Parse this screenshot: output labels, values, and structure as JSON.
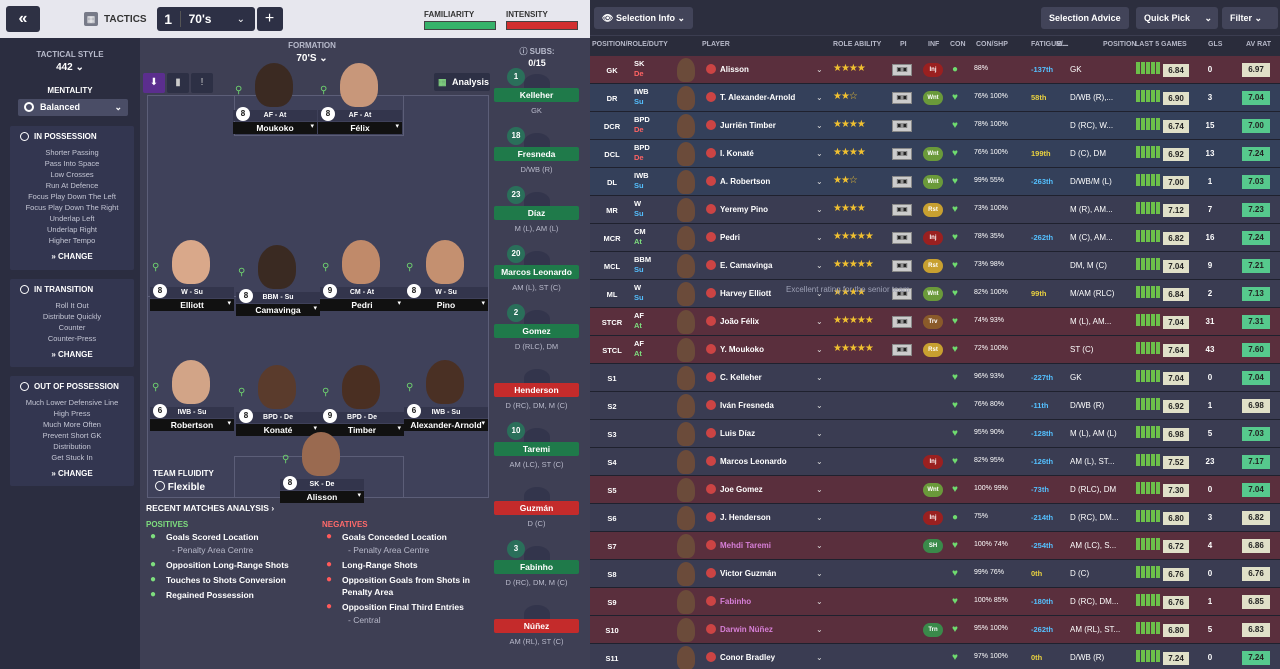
{
  "header": {
    "tactics_label": "TACTICS",
    "slot_number": "1",
    "slot_name": "70's",
    "familiarity_label": "FAMILIARITY",
    "intensity_label": "INTENSITY"
  },
  "sidebar": {
    "style_label": "TACTICAL STYLE",
    "style_value": "442",
    "mentality_label": "MENTALITY",
    "mentality_value": "Balanced",
    "possession": {
      "title": "IN POSSESSION",
      "items": [
        "Shorter Passing",
        "Pass Into Space",
        "Low Crosses",
        "Run At Defence",
        "Focus Play Down The Left",
        "Focus Play Down The Right",
        "Underlap Left",
        "Underlap Right",
        "Higher Tempo"
      ]
    },
    "transition": {
      "title": "IN TRANSITION",
      "items": [
        "Roll It Out",
        "Distribute Quickly",
        "Counter",
        "Counter-Press"
      ]
    },
    "oop": {
      "title": "OUT OF POSSESSION",
      "items": [
        "Much Lower Defensive Line",
        "High Press",
        "Much More Often",
        "Prevent Short GK",
        "Distribution",
        "Get Stuck In"
      ]
    },
    "change_label": "CHANGE"
  },
  "formation": {
    "label": "FORMATION",
    "name": "70'S",
    "analysis_label": "Analysis",
    "fluidity_label": "TEAM FLUIDITY",
    "fluidity_value": "Flexible"
  },
  "pitch_players": [
    {
      "num": "8",
      "role": "AF - At",
      "name": "Moukoko"
    },
    {
      "num": "8",
      "role": "AF - At",
      "name": "Félix"
    },
    {
      "num": "8",
      "role": "W - Su",
      "name": "Elliott"
    },
    {
      "num": "8",
      "role": "BBM - Su",
      "name": "Camavinga"
    },
    {
      "num": "9",
      "role": "CM - At",
      "name": "Pedri"
    },
    {
      "num": "8",
      "role": "W - Su",
      "name": "Pino"
    },
    {
      "num": "6",
      "role": "IWB - Su",
      "name": "Robertson"
    },
    {
      "num": "8",
      "role": "BPD - De",
      "name": "Konaté"
    },
    {
      "num": "9",
      "role": "BPD - De",
      "name": "Timber"
    },
    {
      "num": "6",
      "role": "IWB - Su",
      "name": "Alexander-Arnold"
    },
    {
      "num": "8",
      "role": "SK - De",
      "name": "Alisson"
    }
  ],
  "subs": {
    "label": "SUBS:",
    "count": "0/15",
    "players": [
      {
        "name": "Kelleher",
        "num": "1",
        "pos": "GK"
      },
      {
        "name": "Fresneda",
        "num": "18",
        "pos": "D/WB (R)"
      },
      {
        "name": "Díaz",
        "num": "23",
        "pos": "M (L), AM (L)"
      },
      {
        "name": "Marcos Leonardo",
        "num": "20",
        "pos": "AM (L), ST (C)"
      },
      {
        "name": "Gomez",
        "num": "2",
        "pos": "D (RLC), DM"
      },
      {
        "name": "Henderson",
        "num": "",
        "pos": "D (RC), DM, M (C)"
      },
      {
        "name": "Taremi",
        "num": "10",
        "pos": "AM (LC), ST (C)"
      },
      {
        "name": "Guzmán",
        "num": "",
        "pos": "D (C)"
      },
      {
        "name": "Fabinho",
        "num": "3",
        "pos": "D (RC), DM, M (C)"
      },
      {
        "name": "Núñez",
        "num": "",
        "pos": "AM (RL), ST (C)"
      }
    ]
  },
  "analysis": {
    "title": "RECENT MATCHES ANALYSIS",
    "positives_label": "POSITIVES",
    "negatives_label": "NEGATIVES",
    "positives": [
      "Goals Scored Location",
      "- Penalty Area Centre",
      "Opposition Long-Range Shots",
      "Touches to Shots Conversion",
      "Regained Possession"
    ],
    "negatives": [
      "Goals Conceded Location",
      "- Penalty Area Centre",
      "Long-Range Shots",
      "Opposition Goals from Shots in Penalty Area",
      "Opposition Final Third Entries",
      "- Central"
    ]
  },
  "right_toolbar": {
    "selection_info": "Selection Info",
    "selection_advice": "Selection Advice",
    "quick_pick": "Quick Pick",
    "filter": "Filter"
  },
  "columns": [
    "POSITION/ROLE/DUTY",
    "PLAYER",
    "ROLE ABILITY",
    "PI",
    "INF",
    "CON",
    "CON/SHP",
    "FATIGUE/...",
    "M...",
    "POSITION",
    "LAST 5 GAMES",
    "GLS",
    "AV RAT"
  ],
  "tooltip": "Excellent rating for the senior team",
  "rows": [
    {
      "pos": "GK",
      "role": "SK",
      "duty": "De",
      "name": "Alisson",
      "stars": "★★★★",
      "inf": "Inj",
      "con": "●",
      "cs": "88%",
      "fat": "-137th",
      "gp": "GK",
      "rating": "6.84",
      "gls": "0",
      "av": "6.97"
    },
    {
      "pos": "DR",
      "role": "IWB",
      "duty": "Su",
      "name": "T. Alexander-Arnold",
      "stars": "★★☆",
      "inf": "Wnt",
      "con": "♥",
      "cs": "76% 100%",
      "fat": "58th",
      "gp": "D/WB (R),...",
      "rating": "6.90",
      "gls": "3",
      "av": "7.04"
    },
    {
      "pos": "DCR",
      "role": "BPD",
      "duty": "De",
      "name": "Jurriën Timber",
      "stars": "★★★★",
      "inf": "",
      "con": "♥",
      "cs": "78% 100%",
      "fat": "",
      "gp": "D (RC), W...",
      "rating": "6.74",
      "gls": "15",
      "av": "7.00"
    },
    {
      "pos": "DCL",
      "role": "BPD",
      "duty": "De",
      "name": "I. Konaté",
      "stars": "★★★★",
      "inf": "Wnt",
      "con": "♥",
      "cs": "76% 100%",
      "fat": "199th",
      "gp": "D (C), DM",
      "rating": "6.92",
      "gls": "13",
      "av": "7.24"
    },
    {
      "pos": "DL",
      "role": "IWB",
      "duty": "Su",
      "name": "A. Robertson",
      "stars": "★★☆",
      "inf": "Wnt",
      "con": "♥",
      "cs": "99% 55%",
      "fat": "-263th",
      "gp": "D/WB/M (L)",
      "rating": "7.00",
      "gls": "1",
      "av": "7.03"
    },
    {
      "pos": "MR",
      "role": "W",
      "duty": "Su",
      "name": "Yeremy Pino",
      "stars": "★★★★",
      "inf": "Rst",
      "con": "♥",
      "cs": "73% 100%",
      "fat": "",
      "gp": "M (R), AM...",
      "rating": "7.12",
      "gls": "7",
      "av": "7.23"
    },
    {
      "pos": "MCR",
      "role": "CM",
      "duty": "At",
      "name": "Pedri",
      "stars": "★★★★★",
      "inf": "Inj",
      "con": "♥",
      "cs": "78% 35%",
      "fat": "-262th",
      "gp": "M (C), AM...",
      "rating": "6.82",
      "gls": "16",
      "av": "7.24"
    },
    {
      "pos": "MCL",
      "role": "BBM",
      "duty": "Su",
      "name": "E. Camavinga",
      "stars": "★★★★★",
      "inf": "Rst",
      "con": "♥",
      "cs": "73% 98%",
      "fat": "",
      "gp": "DM, M (C)",
      "rating": "7.04",
      "gls": "9",
      "av": "7.21"
    },
    {
      "pos": "ML",
      "role": "W",
      "duty": "Su",
      "name": "Harvey Elliott",
      "stars": "★★★★",
      "inf": "Wnt",
      "con": "♥",
      "cs": "82% 100%",
      "fat": "99th",
      "gp": "M/AM (RLC)",
      "rating": "6.84",
      "gls": "2",
      "av": "7.13"
    },
    {
      "pos": "STCR",
      "role": "AF",
      "duty": "At",
      "name": "João Félix",
      "stars": "★★★★★",
      "inf": "Trv",
      "con": "♥",
      "cs": "74% 93%",
      "fat": "",
      "gp": "M (L), AM...",
      "rating": "7.04",
      "gls": "31",
      "av": "7.31"
    },
    {
      "pos": "STCL",
      "role": "AF",
      "duty": "At",
      "name": "Y. Moukoko",
      "stars": "★★★★★",
      "inf": "Rst",
      "con": "♥",
      "cs": "72% 100%",
      "fat": "",
      "gp": "ST (C)",
      "rating": "7.64",
      "gls": "43",
      "av": "7.60"
    },
    {
      "pos": "S1",
      "role": "",
      "duty": "",
      "name": "C. Kelleher",
      "stars": "",
      "inf": "",
      "con": "♥",
      "cs": "96% 93%",
      "fat": "-227th",
      "gp": "GK",
      "rating": "7.04",
      "gls": "0",
      "av": "7.04"
    },
    {
      "pos": "S2",
      "role": "",
      "duty": "",
      "name": "Iván Fresneda",
      "stars": "",
      "inf": "",
      "con": "♥",
      "cs": "76% 80%",
      "fat": "-11th",
      "gp": "D/WB (R)",
      "rating": "6.92",
      "gls": "1",
      "av": "6.98"
    },
    {
      "pos": "S3",
      "role": "",
      "duty": "",
      "name": "Luis Díaz",
      "stars": "",
      "inf": "",
      "con": "♥",
      "cs": "95% 90%",
      "fat": "-128th",
      "gp": "M (L), AM (L)",
      "rating": "6.98",
      "gls": "5",
      "av": "7.03"
    },
    {
      "pos": "S4",
      "role": "",
      "duty": "",
      "name": "Marcos Leonardo",
      "stars": "",
      "inf": "Inj",
      "con": "♥",
      "cs": "82% 95%",
      "fat": "-126th",
      "gp": "AM (L), ST...",
      "rating": "7.52",
      "gls": "23",
      "av": "7.17"
    },
    {
      "pos": "S5",
      "role": "",
      "duty": "",
      "name": "Joe Gomez",
      "stars": "",
      "inf": "Wnt",
      "con": "♥",
      "cs": "100% 99%",
      "fat": "-73th",
      "gp": "D (RLC), DM",
      "rating": "7.30",
      "gls": "0",
      "av": "7.04"
    },
    {
      "pos": "S6",
      "role": "",
      "duty": "",
      "name": "J. Henderson",
      "stars": "",
      "inf": "Inj",
      "con": "●",
      "cs": "75%",
      "fat": "-214th",
      "gp": "D (RC), DM...",
      "rating": "6.80",
      "gls": "3",
      "av": "6.82"
    },
    {
      "pos": "S7",
      "role": "",
      "duty": "",
      "name": "Mehdi Taremi",
      "stars": "",
      "inf": "SH",
      "con": "♥",
      "cs": "100% 74%",
      "fat": "-254th",
      "gp": "AM (LC), S...",
      "rating": "6.72",
      "gls": "4",
      "av": "6.86"
    },
    {
      "pos": "S8",
      "role": "",
      "duty": "",
      "name": "Victor Guzmán",
      "stars": "",
      "inf": "",
      "con": "♥",
      "cs": "99% 76%",
      "fat": "0th",
      "gp": "D (C)",
      "rating": "6.76",
      "gls": "0",
      "av": "6.76"
    },
    {
      "pos": "S9",
      "role": "",
      "duty": "",
      "name": "Fabinho",
      "stars": "",
      "inf": "",
      "con": "♥",
      "cs": "100% 85%",
      "fat": "-180th",
      "gp": "D (RC), DM...",
      "rating": "6.76",
      "gls": "1",
      "av": "6.85"
    },
    {
      "pos": "S10",
      "role": "",
      "duty": "",
      "name": "Darwin Núñez",
      "stars": "",
      "inf": "Trn",
      "con": "♥",
      "cs": "95% 100%",
      "fat": "-262th",
      "gp": "AM (RL), ST...",
      "rating": "6.80",
      "gls": "5",
      "av": "6.83"
    },
    {
      "pos": "S11",
      "role": "",
      "duty": "",
      "name": "Conor Bradley",
      "stars": "",
      "inf": "",
      "con": "♥",
      "cs": "97% 100%",
      "fat": "0th",
      "gp": "D/WB (R)",
      "rating": "7.24",
      "gls": "0",
      "av": "7.24"
    }
  ],
  "colors": {
    "accent_green": "#1f7a4a",
    "accent_red": "#c42b2b",
    "row_red": "#5a2f3d",
    "row_blue": "#34405a",
    "rating_green": "#56c98d"
  }
}
